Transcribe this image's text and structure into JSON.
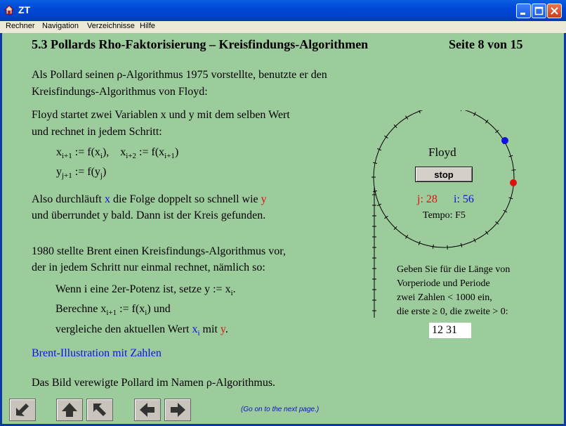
{
  "window": {
    "title": "ZT"
  },
  "menu": [
    "Rechner",
    "Navigation",
    "Verzeichnisse",
    "Hilfe"
  ],
  "heading": "5.3 Pollards Rho-Faktorisierung – Kreisfindungs-Algorithmen",
  "page": "Seite 8 von 15",
  "para1": [
    "Als Pollard seinen ρ-Algorithmus 1975 vorstellte, benutzte er den",
    "Kreisfindungs-Algorithmus von Floyd:"
  ],
  "para2": [
    "Floyd startet zwei Variablen x und y mit dem selben Wert",
    "und rechnet in jedem Schritt:"
  ],
  "para3": {
    "a": "Also durchläuft ",
    "x": "x",
    "b": " die Folge doppelt so schnell wie ",
    "y": "y",
    "line2": "und überrundet y bald. Dann ist der Kreis gefunden."
  },
  "para4": [
    "1980 stellte Brent einen Kreisfindungs-Algorithmus vor,",
    "der in jedem Schritt nur einmal rechnet, nämlich so:"
  ],
  "brent": {
    "l1": "Wenn i eine 2er-Potenz ist, setze y := x",
    "l2a": "Berechne  x",
    "l2b": " := f(x",
    "l2c": ")  und",
    "l3a": "vergleiche den aktuellen Wert ",
    "l3x": "x",
    "l3b": " mit ",
    "l3y": "y",
    "l3c": "."
  },
  "link": "Brent-Illustration mit Zahlen",
  "last": "Das Bild verewigte Pollard im Namen ρ-Algorithmus.",
  "floyd": {
    "title": "Floyd",
    "stop": "stop",
    "j": "j: 28",
    "i": "i: 56",
    "tempo": "Tempo: F5"
  },
  "hint": [
    "Geben Sie für die Länge von",
    "Vorperiode und Periode",
    "zwei Zahlen < 1000 ein,",
    "die erste ≥ 0, die zweite > 0:"
  ],
  "input_value": "12 31",
  "nav_hint": "(Go on to the next page.)",
  "colors": {
    "blue": "#1010e0",
    "red": "#e01010",
    "background": "#9ccc9c"
  }
}
